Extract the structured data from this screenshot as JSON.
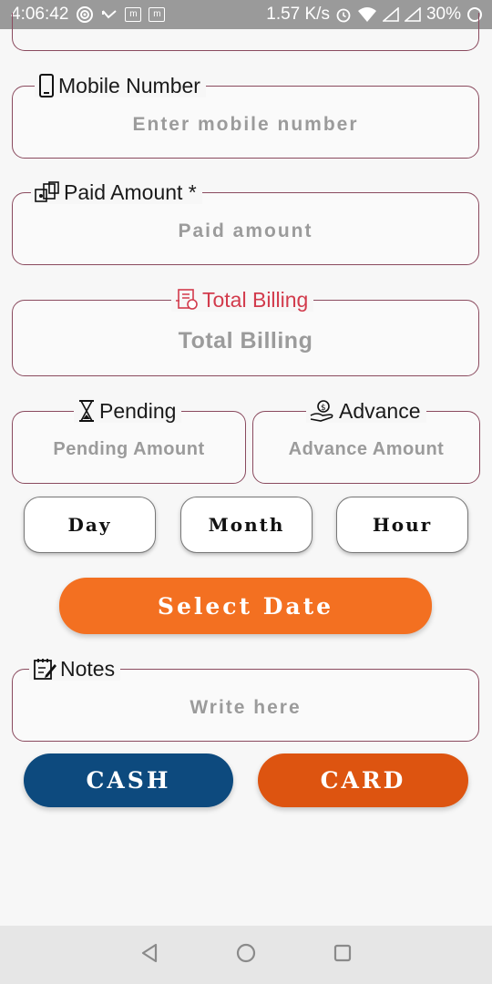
{
  "status_bar": {
    "time": "4:06:42",
    "net_speed": "1.57 K/s",
    "battery": "30%",
    "notif_m1": "m",
    "notif_m2": "m"
  },
  "form": {
    "mobile": {
      "label": "Mobile Number",
      "placeholder": "Enter mobile number"
    },
    "paid": {
      "label": "Paid Amount *",
      "placeholder": "Paid amount"
    },
    "total": {
      "label": "Total Billing",
      "placeholder": "Total Billing",
      "color": "#d23b4c"
    },
    "pending": {
      "label": "Pending",
      "placeholder": "Pending Amount"
    },
    "advance": {
      "label": "Advance",
      "placeholder": "Advance Amount"
    },
    "notes": {
      "label": "Notes",
      "placeholder": "Write here"
    }
  },
  "period_options": [
    "Day",
    "Month",
    "Hour"
  ],
  "select_date": {
    "label": "Select Date",
    "color": "#f37021"
  },
  "payment": {
    "cash": {
      "label": "CASH",
      "color": "#0d4a7e"
    },
    "card": {
      "label": "CARD",
      "color": "#dd5410"
    }
  },
  "nav": {
    "back_icon": "triangle-back-icon",
    "home_icon": "circle-home-icon",
    "recents_icon": "square-recents-icon"
  }
}
